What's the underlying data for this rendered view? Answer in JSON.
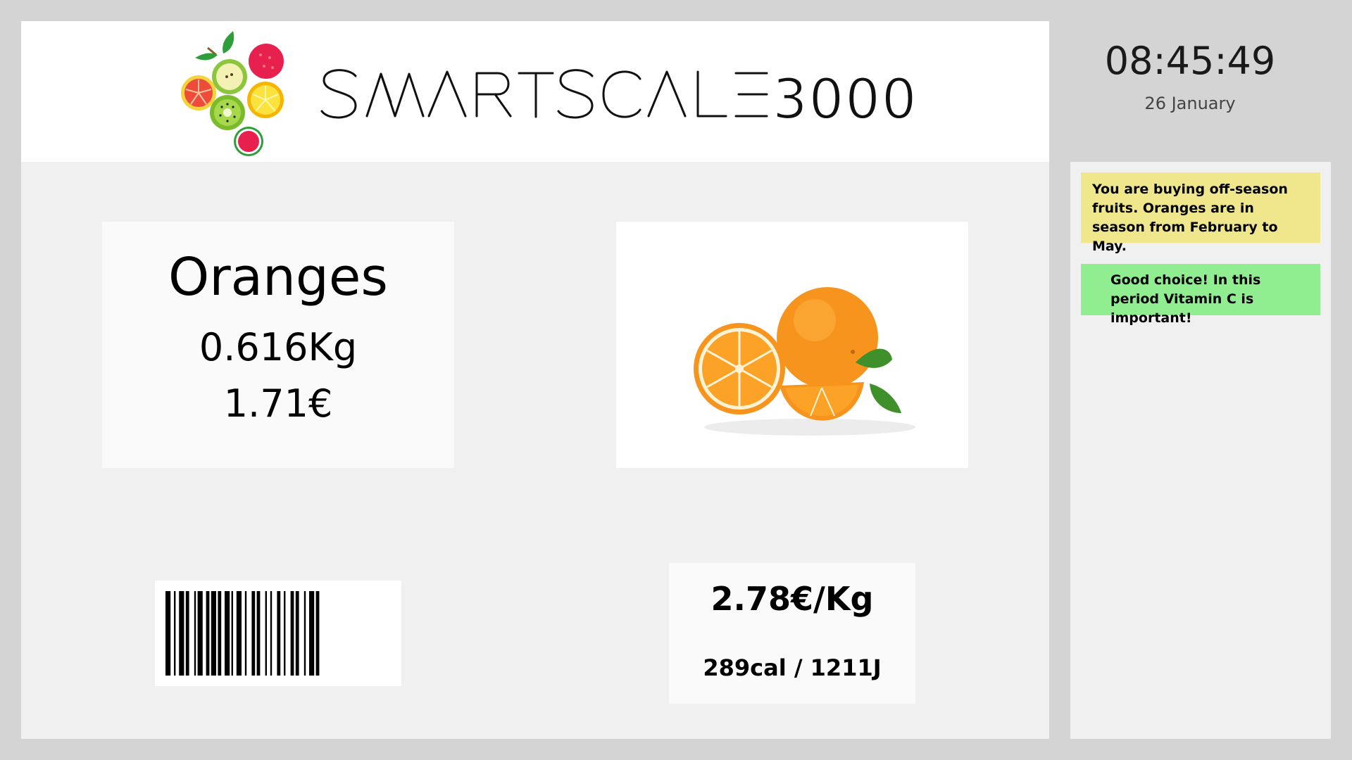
{
  "header": {
    "brand_name": "SMARTSCALE3000"
  },
  "product": {
    "name": "Oranges",
    "weight": "0.616Kg",
    "price": "1.71€",
    "image": "orange-fruit-photo"
  },
  "pricing": {
    "unit_price": "2.78€/Kg",
    "calories": "289cal / 1211J"
  },
  "clock": {
    "time": "08:45:49",
    "date": "26 January"
  },
  "notices": {
    "season_warning": "You are buying off-season fruits. Oranges are in season from February to May.",
    "health_tip": "Good choice! In this period Vitamin C is important!"
  },
  "colors": {
    "warning_bg": "#f0e68c",
    "info_bg": "#90ee90",
    "accent_orange": "#f7941d"
  },
  "icons": {
    "logo": "fruit-slices-logo",
    "barcode": "barcode-icon"
  }
}
